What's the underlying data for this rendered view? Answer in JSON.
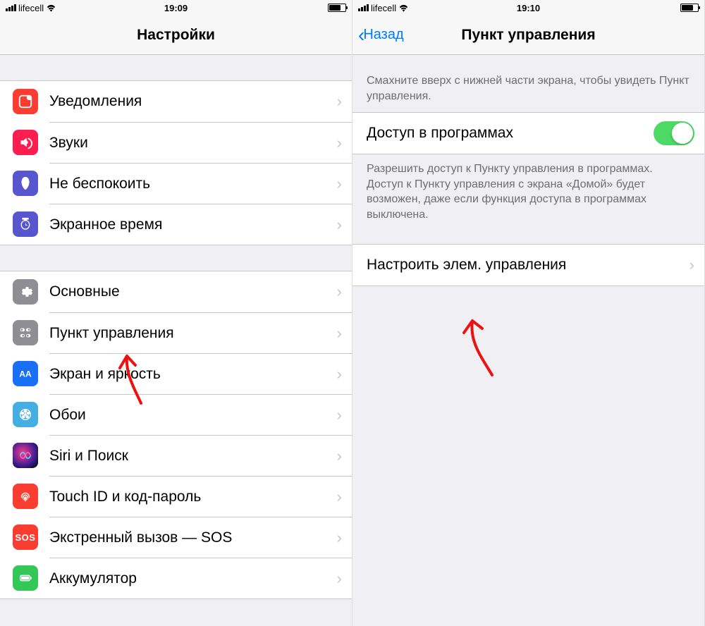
{
  "left": {
    "status": {
      "carrier": "lifecell",
      "time": "19:09"
    },
    "title": "Настройки",
    "group1": [
      {
        "id": "notifications",
        "label": "Уведомления",
        "icon": "notif"
      },
      {
        "id": "sounds",
        "label": "Звуки",
        "icon": "sound"
      },
      {
        "id": "dnd",
        "label": "Не беспокоить",
        "icon": "dnd"
      },
      {
        "id": "screentime",
        "label": "Экранное время",
        "icon": "screentime"
      }
    ],
    "group2": [
      {
        "id": "general",
        "label": "Основные",
        "icon": "general"
      },
      {
        "id": "controlcenter",
        "label": "Пункт управления",
        "icon": "control"
      },
      {
        "id": "display",
        "label": "Экран и яркость",
        "icon": "display"
      },
      {
        "id": "wallpaper",
        "label": "Обои",
        "icon": "wallpaper"
      },
      {
        "id": "siri",
        "label": "Siri и Поиск",
        "icon": "siri"
      },
      {
        "id": "touchid",
        "label": "Touch ID и код-пароль",
        "icon": "touchid"
      },
      {
        "id": "sos",
        "label": "Экстренный вызов — SOS",
        "icon": "sos"
      },
      {
        "id": "battery",
        "label": "Аккумулятор",
        "icon": "battery"
      }
    ]
  },
  "right": {
    "status": {
      "carrier": "lifecell",
      "time": "19:10"
    },
    "back": "Назад",
    "title": "Пункт управления",
    "intro": "Смахните вверх с нижней части экрана, чтобы увидеть Пункт управления.",
    "toggle_label": "Доступ в программах",
    "toggle_on": true,
    "toggle_footer": "Разрешить доступ к Пункту управления в программах. Доступ к Пункту управления с экрана «Домой» будет возможен, даже если функция доступа в программах выключена.",
    "customize_label": "Настроить элем. управления"
  }
}
